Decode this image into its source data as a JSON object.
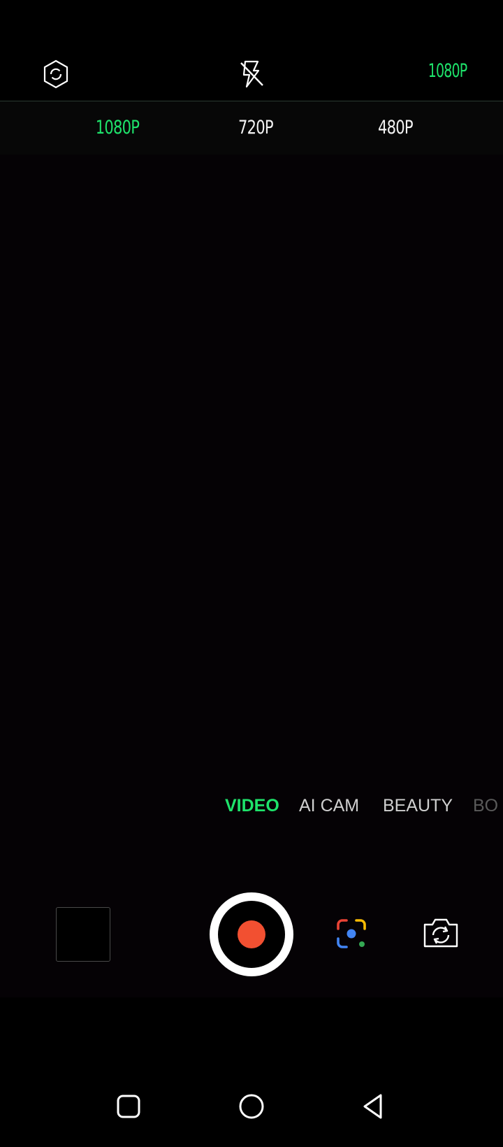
{
  "top_bar": {
    "settings_icon": "hexagon-settings-icon",
    "flash_icon": "flash-off-icon",
    "current_resolution": "1080P",
    "accent_color": "#1ee36b"
  },
  "resolution_options": [
    {
      "label": "1080P",
      "active": true
    },
    {
      "label": "720P",
      "active": false
    },
    {
      "label": "480P",
      "active": false
    }
  ],
  "modes": [
    {
      "label": "VIDEO",
      "active": true
    },
    {
      "label": "AI CAM",
      "active": false
    },
    {
      "label": "BEAUTY",
      "active": false
    },
    {
      "label": "BO",
      "active": false
    }
  ],
  "controls": {
    "gallery_icon": "gallery-thumbnail",
    "shutter_icon": "record-icon",
    "shutter_color": "#f25031",
    "lens_icon": "google-lens-icon",
    "flip_icon": "camera-flip-icon"
  },
  "nav": {
    "recents_icon": "recents-square-icon",
    "home_icon": "home-circle-icon",
    "back_icon": "back-triangle-icon"
  }
}
